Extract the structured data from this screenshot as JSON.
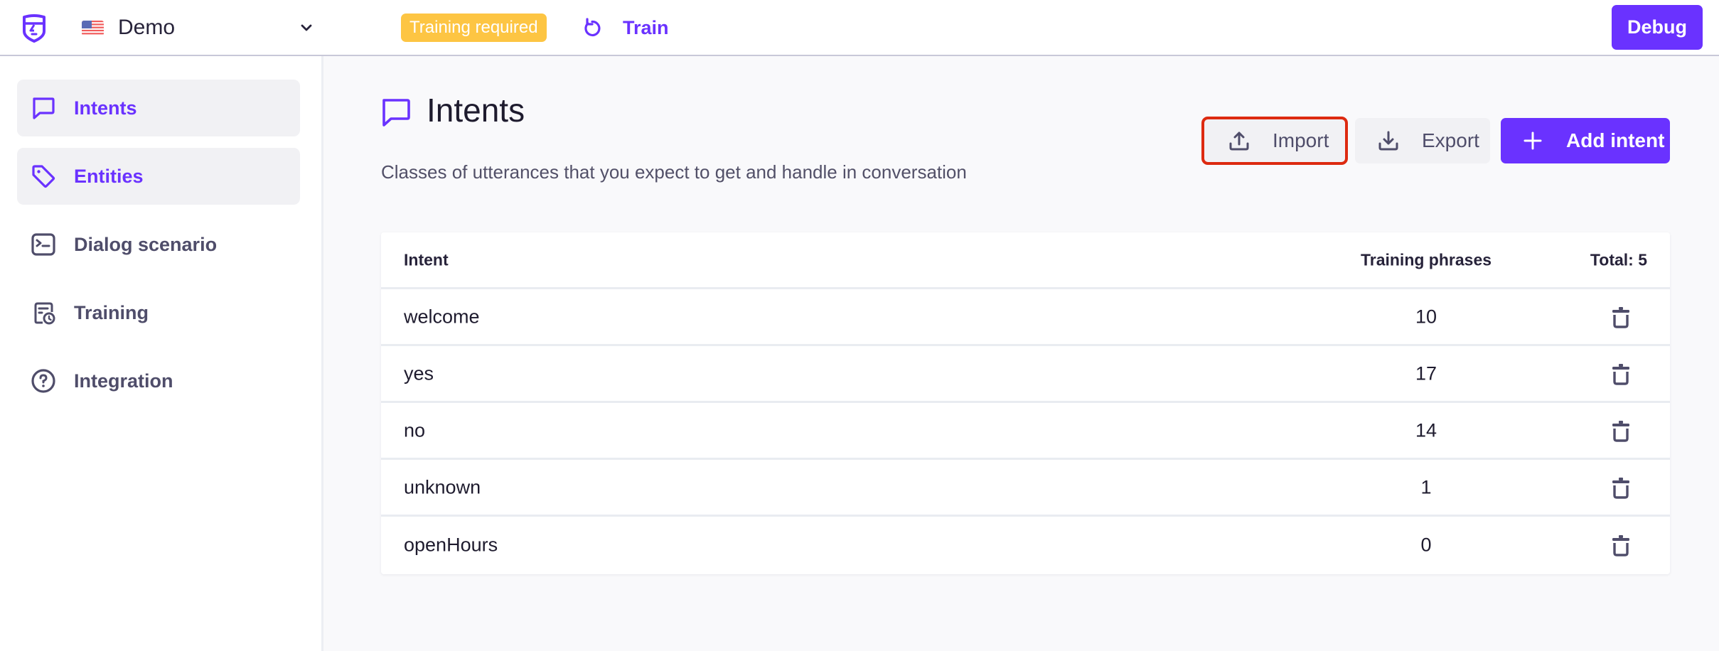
{
  "header": {
    "logo": "shield-face-logo",
    "project": {
      "name": "Demo",
      "flag": "us-flag",
      "dropdown_icon": "chevron-down"
    },
    "badge": "Training required",
    "train_label": "Train",
    "debug_label": "Debug"
  },
  "sidebar": {
    "items": [
      {
        "label": "Intents",
        "icon": "chat-bubble",
        "active": true
      },
      {
        "label": "Entities",
        "icon": "tag",
        "active": true
      },
      {
        "label": "Dialog scenario",
        "icon": "terminal",
        "active": false
      },
      {
        "label": "Training",
        "icon": "schedule-list",
        "active": false
      },
      {
        "label": "Integration",
        "icon": "help-circle",
        "active": false
      }
    ]
  },
  "main": {
    "title": "Intents",
    "subtitle": "Classes of utterances that you expect to get and handle in conversation",
    "buttons": {
      "import": "Import",
      "export": "Export",
      "add": "Add intent"
    },
    "table": {
      "headers": {
        "intent": "Intent",
        "phrases": "Training phrases",
        "total": "Total: 5"
      },
      "rows": [
        {
          "name": "welcome",
          "phrases": "10"
        },
        {
          "name": "yes",
          "phrases": "17"
        },
        {
          "name": "no",
          "phrases": "14"
        },
        {
          "name": "unknown",
          "phrases": "1"
        },
        {
          "name": "openHours",
          "phrases": "0"
        }
      ]
    }
  },
  "colors": {
    "accent": "#6a32ff",
    "badge": "#fdc543",
    "highlight_outline": "#dd2a10",
    "text_muted": "#4f4d6a"
  }
}
